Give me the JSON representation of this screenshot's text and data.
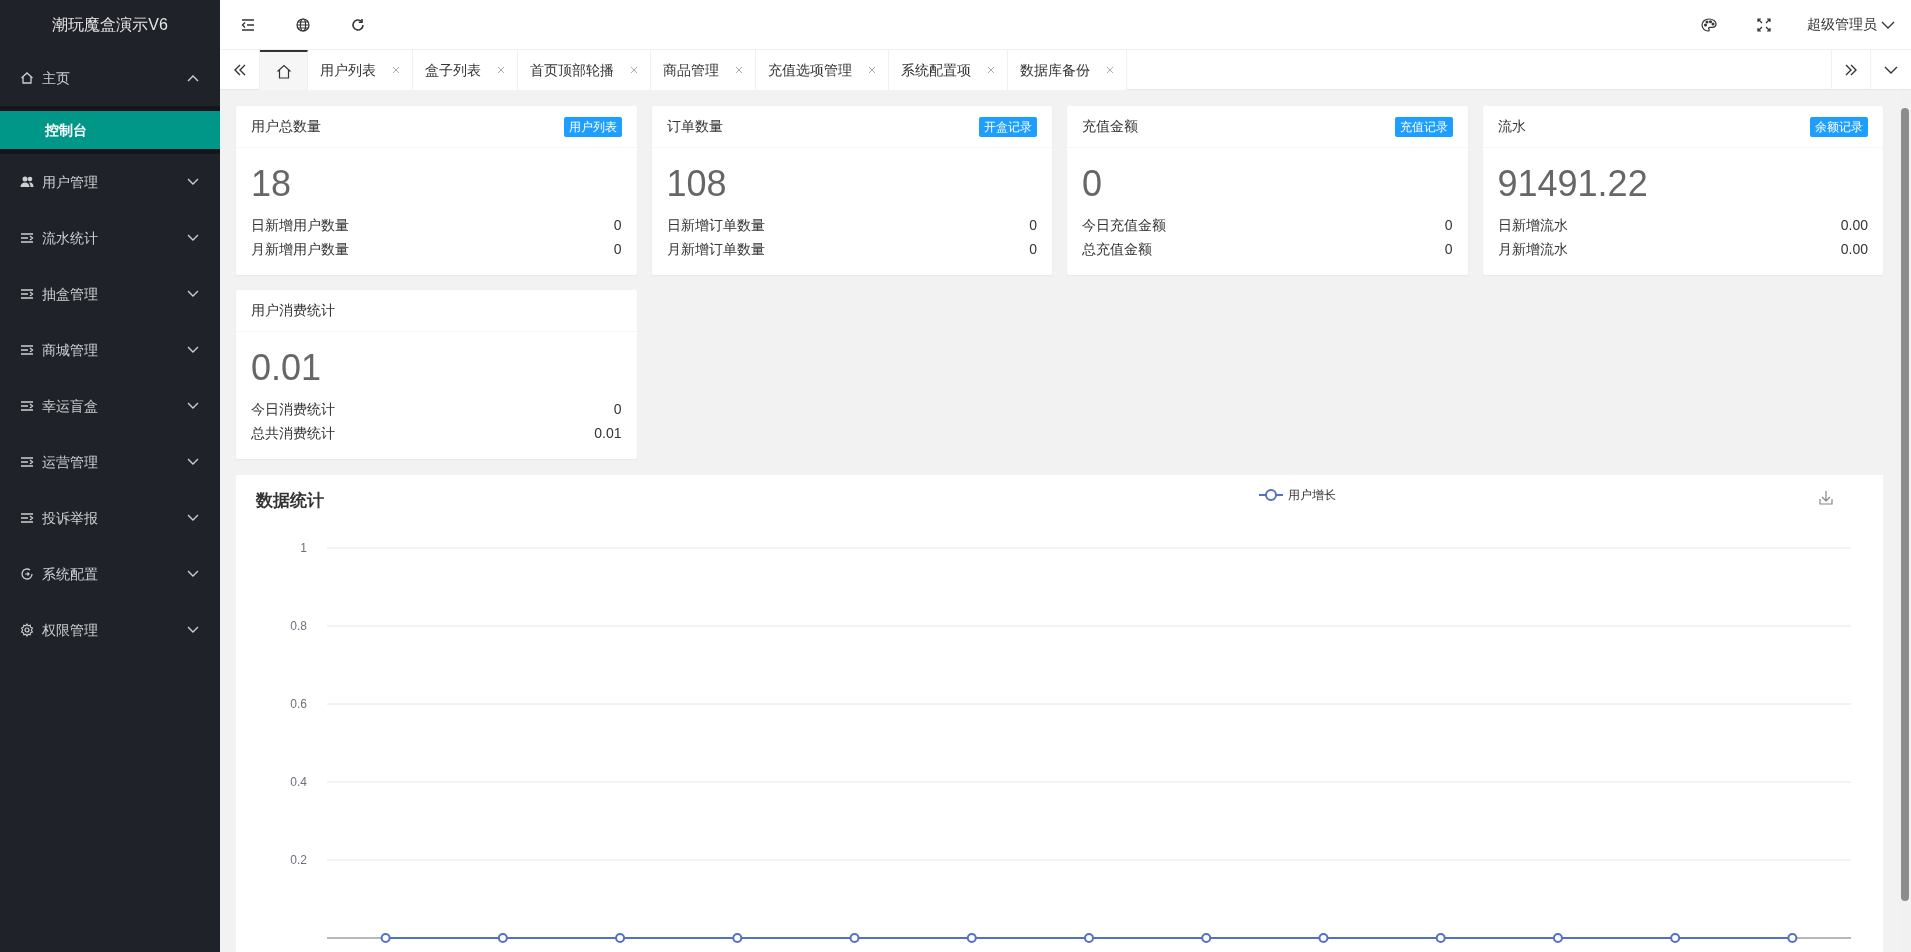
{
  "app_title": "潮玩魔盒演示V6",
  "sidebar": {
    "items": [
      {
        "label": "主页",
        "kind": "home",
        "expanded": true,
        "children": [
          {
            "label": "控制台",
            "selected": true
          }
        ]
      },
      {
        "label": "用户管理",
        "kind": "users",
        "expanded": false
      },
      {
        "label": "流水统计",
        "kind": "list",
        "expanded": false
      },
      {
        "label": "抽盒管理",
        "kind": "list",
        "expanded": false
      },
      {
        "label": "商城管理",
        "kind": "list",
        "expanded": false
      },
      {
        "label": "幸运盲盒",
        "kind": "list",
        "expanded": false
      },
      {
        "label": "运营管理",
        "kind": "list",
        "expanded": false
      },
      {
        "label": "投诉举报",
        "kind": "list",
        "expanded": false
      },
      {
        "label": "系统配置",
        "kind": "cycle",
        "expanded": false
      },
      {
        "label": "权限管理",
        "kind": "gear",
        "expanded": false
      }
    ]
  },
  "header": {
    "user": "超级管理员"
  },
  "home_tab": {
    "selected": true
  },
  "tabs": [
    {
      "label": "用户列表",
      "selected": false
    },
    {
      "label": "盒子列表",
      "selected": false
    },
    {
      "label": "首页顶部轮播",
      "selected": false
    },
    {
      "label": "商品管理",
      "selected": false
    },
    {
      "label": "充值选项管理",
      "selected": false
    },
    {
      "label": "系统配置项",
      "selected": false
    },
    {
      "label": "数据库备份",
      "selected": false
    }
  ],
  "stats": [
    {
      "title": "用户总数量",
      "badge": "用户列表",
      "value": "18",
      "rows": [
        {
          "label": "日新增用户数量",
          "value": "0"
        },
        {
          "label": "月新增用户数量",
          "value": "0"
        }
      ]
    },
    {
      "title": "订单数量",
      "badge": "开盒记录",
      "value": "108",
      "rows": [
        {
          "label": "日新增订单数量",
          "value": "0"
        },
        {
          "label": "月新增订单数量",
          "value": "0"
        }
      ]
    },
    {
      "title": "充值金额",
      "badge": "充值记录",
      "value": "0",
      "rows": [
        {
          "label": "今日充值金额",
          "value": "0"
        },
        {
          "label": "总充值金额",
          "value": "0"
        }
      ]
    },
    {
      "title": "流水",
      "badge": "余额记录",
      "value": "91491.22",
      "rows": [
        {
          "label": "日新增流水",
          "value": "0.00"
        },
        {
          "label": "月新增流水",
          "value": "0.00"
        }
      ]
    },
    {
      "title": "用户消费统计",
      "value": "0.01",
      "rows": [
        {
          "label": "今日消费统计",
          "value": "0"
        },
        {
          "label": "总共消费统计",
          "value": "0.01"
        }
      ]
    }
  ],
  "chart_panel": {
    "title": "数据统计",
    "chart_data": {
      "type": "line",
      "grid": true,
      "ylim": [
        0,
        1
      ],
      "yticks": [
        0.2,
        0.4,
        0.6,
        0.8,
        1
      ],
      "series": [
        {
          "name": "用户增长",
          "color": "#5470c6",
          "marker": true,
          "values": [
            0,
            0,
            0,
            0,
            0,
            0,
            0,
            0,
            0,
            0,
            0,
            0,
            0
          ]
        }
      ]
    }
  }
}
